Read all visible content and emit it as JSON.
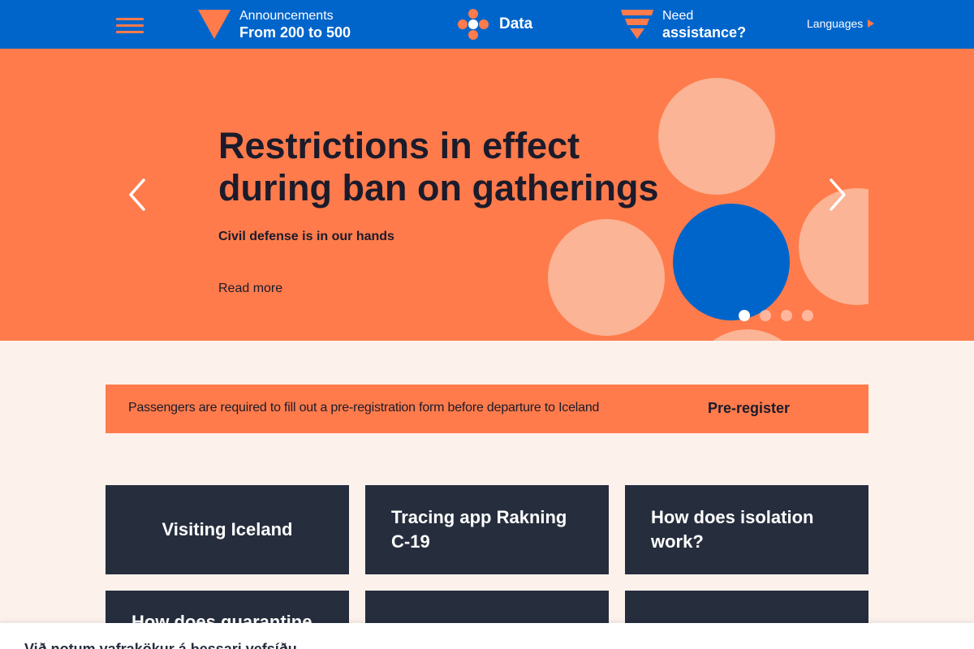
{
  "nav": {
    "announcements": {
      "label": "Announcements",
      "value": "From 200 to 500"
    },
    "data": {
      "label": "Data"
    },
    "assistance": {
      "label": "Need",
      "value": "assistance?"
    },
    "languages": "Languages"
  },
  "hero": {
    "title_line1": "Restrictions in effect",
    "title_line2": "during ban on gatherings",
    "subtitle": "Civil defense is in our hands",
    "link": "Read more",
    "slide_count": 4,
    "active_slide": 1
  },
  "banner": {
    "text": "Passengers are required to fill out a pre-registration form before departure to Iceland",
    "button": "Pre-register"
  },
  "tiles": [
    {
      "line1": "Visiting Iceland",
      "line2": ""
    },
    {
      "line1": "Tracing app Rakning",
      "line2": "C-19"
    },
    {
      "line1": "How does isolation",
      "line2": "work?"
    },
    {
      "line1": "How does quarantine",
      "line2": ""
    },
    {
      "line1": "",
      "line2": ""
    },
    {
      "line1": "",
      "line2": ""
    }
  ],
  "cookie": {
    "text": "Við notum vafrakökur á þessari vefsíðu"
  },
  "colors": {
    "nav_bg": "#0065cb",
    "accent_orange": "#ff7b4b",
    "light_bubble": "#fbb495",
    "blue_bubble": "#0065cb",
    "tile_bg": "#262e3e",
    "page_bg": "#fdf1ec"
  },
  "icons": {
    "menu": "hamburger-icon",
    "announcements": "triangle-icon",
    "data": "dots-cluster-icon",
    "assistance": "funnel-icon",
    "languages": "triangle-right-icon",
    "prev": "chevron-left-icon",
    "next": "chevron-right-icon"
  }
}
